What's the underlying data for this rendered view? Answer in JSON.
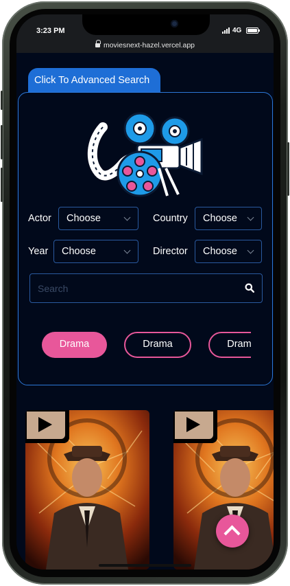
{
  "status_bar": {
    "time": "3:23 PM",
    "network": "4G"
  },
  "browser": {
    "url": "moviesnext-hazel.vercel.app"
  },
  "advanced_search": {
    "tab_label": "Click To Advanced Search",
    "filters": {
      "actor": {
        "label": "Actor",
        "value": "Choose"
      },
      "country": {
        "label": "Country",
        "value": "Choose"
      },
      "year": {
        "label": "Year",
        "value": "Choose"
      },
      "director": {
        "label": "Director",
        "value": "Choose"
      }
    },
    "search": {
      "placeholder": "Search",
      "value": ""
    },
    "genres": [
      {
        "label": "Drama",
        "active": true
      },
      {
        "label": "Drama",
        "active": false
      },
      {
        "label": "Drama",
        "active": false
      }
    ]
  },
  "icons": {
    "illustration": "movie-camera-illustration",
    "search": "search-icon",
    "play": "play-icon",
    "scroll_top": "chevron-up-icon"
  },
  "colors": {
    "background": "#01091b",
    "accent_blue": "#1e6ed6",
    "accent_pink": "#e8579a",
    "border_blue": "#2c78d8"
  }
}
